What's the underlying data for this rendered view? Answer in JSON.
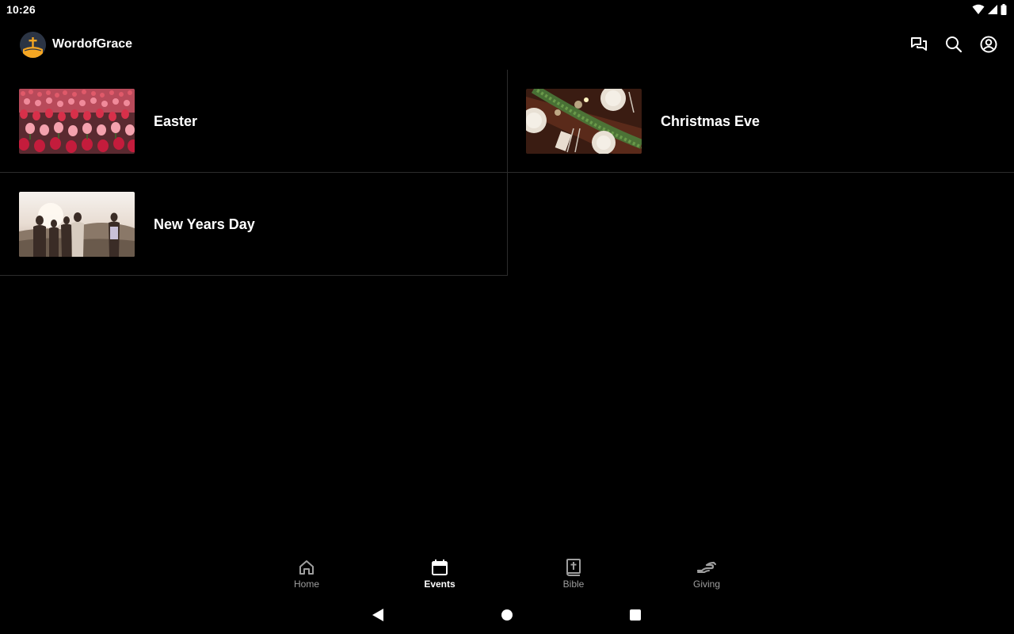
{
  "status_bar": {
    "time": "10:26"
  },
  "app_bar": {
    "title": "WordofGrace",
    "actions": [
      "chat-icon",
      "search-icon",
      "account-icon"
    ]
  },
  "events": [
    {
      "title": "Easter",
      "image": "tulips-photo"
    },
    {
      "title": "Christmas Eve",
      "image": "dinner-table-photo"
    },
    {
      "title": "New Years Day",
      "image": "friends-sunset-photo"
    }
  ],
  "bottom_nav": {
    "items": [
      {
        "label": "Home",
        "icon": "home-icon",
        "active": false
      },
      {
        "label": "Events",
        "icon": "calendar-icon",
        "active": true
      },
      {
        "label": "Bible",
        "icon": "bible-icon",
        "active": false
      },
      {
        "label": "Giving",
        "icon": "giving-hand-icon",
        "active": false
      }
    ]
  },
  "colors": {
    "background": "#000000",
    "divider": "#2c2c2c",
    "inactive_label": "#9e9e9e",
    "logo_accent": "#f5a623"
  }
}
